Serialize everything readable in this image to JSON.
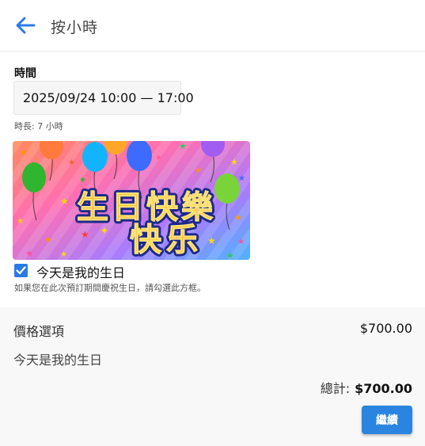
{
  "header": {
    "title": "按小時",
    "back_icon": "arrow-left-icon",
    "accent_color": "#2c7be5"
  },
  "time": {
    "label": "時間",
    "value": "2025/09/24 10:00 — 17:00",
    "duration": "時長: 7 小時"
  },
  "birthday_image": {
    "line1": [
      "生",
      "日",
      "快",
      "樂"
    ],
    "line2": [
      "快",
      "乐"
    ],
    "line1_colors": [
      "#ff9b1a",
      "#ffb21f",
      "#ffc51f",
      "#ffae1e"
    ],
    "line2_colors": [
      "#ffc522",
      "#ffb01d"
    ]
  },
  "checkbox": {
    "checked": true,
    "label": "今天是我的生日",
    "hint": "如果您在此次預訂期間慶祝生日，請勾選此方框。"
  },
  "summary": {
    "price_title": "價格選項",
    "price_value": "$700.00",
    "birthday_line": "今天是我的生日",
    "total_label": "總計:",
    "total_value": "$700.00",
    "continue_label": "繼續",
    "button_color": "#2b85e0"
  }
}
